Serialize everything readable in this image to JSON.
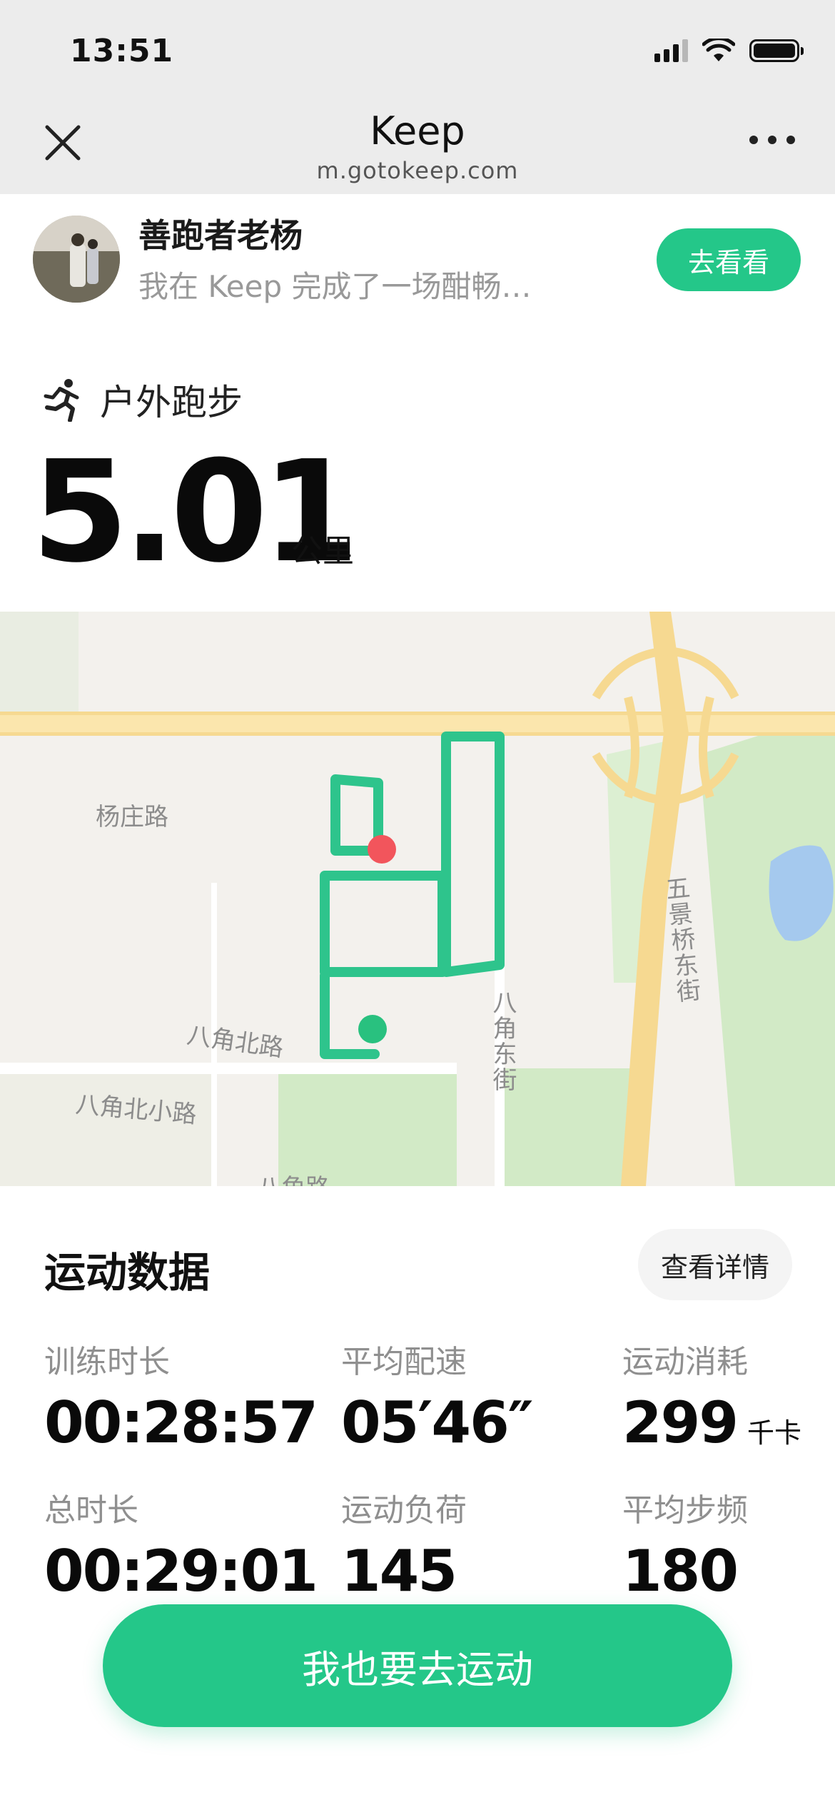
{
  "status_bar": {
    "time": "13:51"
  },
  "nav": {
    "title": "Keep",
    "url": "m.gotokeep.com"
  },
  "share": {
    "username": "善跑者老杨",
    "description": "我在 Keep 完成了一场酣畅…",
    "button_label": "去看看"
  },
  "activity": {
    "type_label": "户外跑步",
    "distance": "5.01",
    "distance_unit": "公里"
  },
  "map": {
    "labels": {
      "yangzhuang_rd": "杨庄路",
      "bajiao_north_rd": "八角北路",
      "bajiao_north_small_rd": "八角北小路",
      "bajiao_east_st": "八角东街",
      "wujingqiao_east_st": "五景桥东街",
      "bottom_partial": "八角路"
    },
    "colors": {
      "route": "#2ec48c",
      "start": "#29c17f",
      "end": "#f2555c",
      "road": "#f7d98a",
      "green": "#cfe8c4",
      "water": "#9ec8f0"
    }
  },
  "stats": {
    "title": "运动数据",
    "detail_button": "查看详情",
    "items": [
      {
        "label": "训练时长",
        "value": "00:28:57",
        "unit": ""
      },
      {
        "label": "平均配速",
        "value": "05′46″",
        "unit": ""
      },
      {
        "label": "运动消耗",
        "value": "299",
        "unit": "千卡"
      },
      {
        "label": "总时长",
        "value": "00:29:01",
        "unit": ""
      },
      {
        "label": "运动负荷",
        "value": "145",
        "unit": ""
      },
      {
        "label": "平均步频",
        "value": "180",
        "unit": ""
      }
    ]
  },
  "cta": {
    "label": "我也要去运动"
  }
}
